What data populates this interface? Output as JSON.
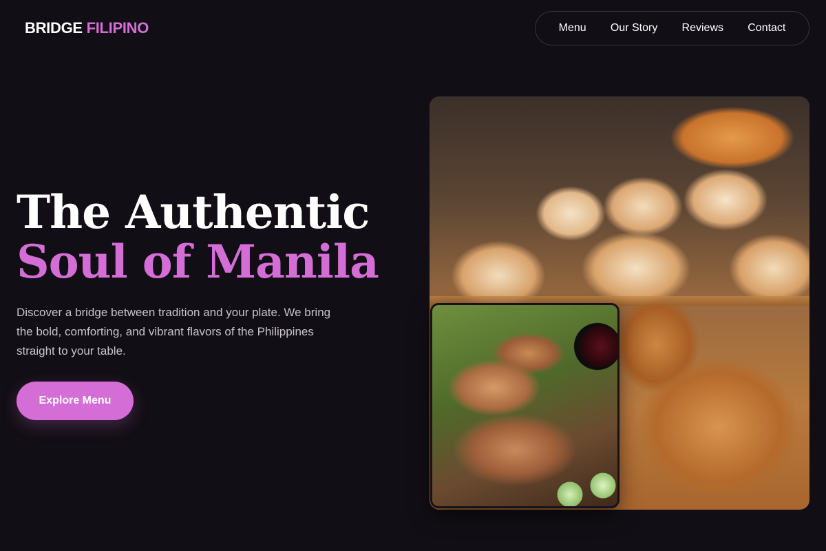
{
  "brand": {
    "name_part1": "BRIDGE",
    "name_part2": "FILIPINO",
    "accent_color": "#d46ed6"
  },
  "nav": {
    "items": [
      {
        "label": "Menu"
      },
      {
        "label": "Our Story"
      },
      {
        "label": "Reviews"
      },
      {
        "label": "Contact"
      }
    ]
  },
  "hero": {
    "title_line1": "The Authentic",
    "title_line2": "Soul of Manila",
    "description": "Discover a bridge between tradition and your plate. We bring the bold, comforting, and vibrant flavors of the Philippines straight to your table.",
    "cta_label": "Explore Menu"
  },
  "images": {
    "main": {
      "alt": "pandesal-bread-photo"
    },
    "inset": {
      "alt": "lechon-kawali-photo"
    }
  },
  "colors": {
    "background": "#120e15",
    "accent": "#d46ed6",
    "text_muted": "#c9c3cc"
  }
}
